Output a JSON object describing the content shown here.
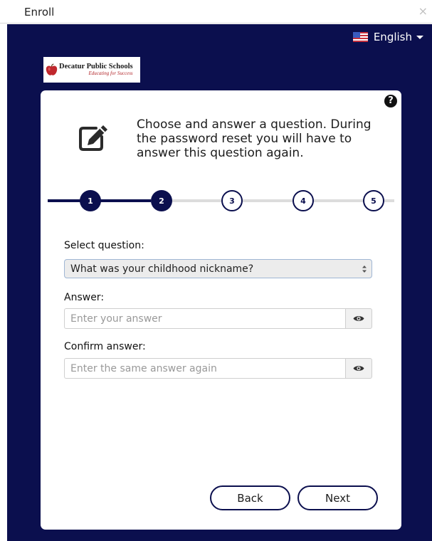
{
  "window": {
    "title": "Enroll",
    "close_glyph": "×"
  },
  "language": {
    "label": "English",
    "flag_icon": "us-flag-icon"
  },
  "logo": {
    "name": "Decatur Public Schools",
    "tagline": "Educating for Success"
  },
  "card": {
    "help_glyph": "?",
    "instruction": "Choose and answer a question. During the password reset you will have to answer this question again."
  },
  "stepper": {
    "steps": [
      "1",
      "2",
      "3",
      "4",
      "5"
    ],
    "current_step": 2
  },
  "form": {
    "question_label": "Select question:",
    "question_value": "What was your childhood nickname?",
    "answer_label": "Answer:",
    "answer_placeholder": "Enter your answer",
    "confirm_label": "Confirm answer:",
    "confirm_placeholder": "Enter the same answer again"
  },
  "actions": {
    "back_label": "Back",
    "next_label": "Next"
  },
  "colors": {
    "navy": "#0b0f4e",
    "track_gray": "#dcdcdc",
    "select_border": "#9fb6d4"
  }
}
